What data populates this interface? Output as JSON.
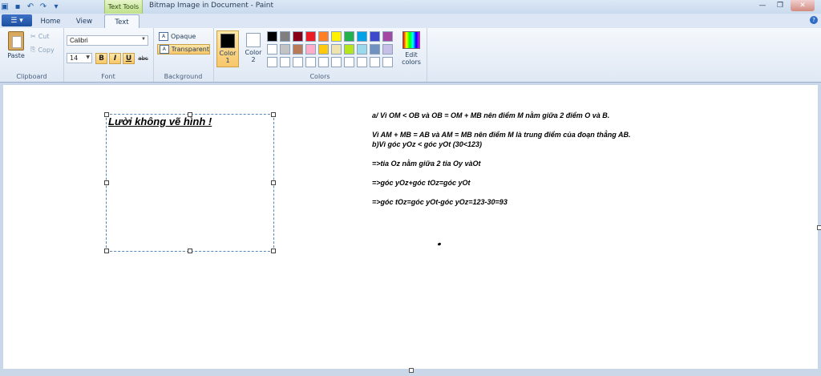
{
  "titlebar": {
    "context_tab": "Text Tools",
    "window_title": "Bitmap Image in Document - Paint",
    "qat_icons": [
      "paint-icon",
      "save-icon",
      "undo-icon",
      "redo-icon",
      "customize-icon"
    ]
  },
  "tabs": [
    {
      "label": "Home"
    },
    {
      "label": "View"
    },
    {
      "label": "Text"
    }
  ],
  "ribbon": {
    "clipboard": {
      "paste": "Paste",
      "cut": "Cut",
      "copy": "Copy",
      "group_label": "Clipboard"
    },
    "font": {
      "family": "Calibri",
      "size": "14",
      "bold": "B",
      "italic": "I",
      "underline": "U",
      "strike": "abc",
      "group_label": "Font"
    },
    "background": {
      "opaque": "Opaque",
      "transparent": "Transparent",
      "group_label": "Background"
    },
    "colors": {
      "color1_label": "Color 1",
      "color2_label": "Color 2",
      "color1": "#000000",
      "color2": "#ffffff",
      "edit_label": "Edit colors",
      "group_label": "Colors",
      "palette": [
        "#000000",
        "#7f7f7f",
        "#880015",
        "#ed1c24",
        "#ff7f27",
        "#fff200",
        "#22b14c",
        "#00a2e8",
        "#3f48cc",
        "#a349a4",
        "#ffffff",
        "#c3c3c3",
        "#b97a57",
        "#ffaec9",
        "#ffc90e",
        "#efe4b0",
        "#b5e61d",
        "#99d9ea",
        "#7092be",
        "#c8bfe7",
        "#ffffff",
        "#ffffff",
        "#ffffff",
        "#ffffff",
        "#ffffff",
        "#ffffff",
        "#ffffff",
        "#ffffff",
        "#ffffff",
        "#ffffff"
      ]
    }
  },
  "canvas": {
    "textbox_text": "Lười không vẽ hình !",
    "lines": [
      "a/ Vì OM < OB và OB = OM + MB nên điểm M nằm giữa 2 điểm O và B.",
      "Vì AM + MB = AB và AM = MB nên điểm M là trung điểm của đoạn thẳng AB.",
      "b)Vì góc yOz < góc yOt  (30<123)",
      "=>tia Oz nằm giữa 2 tia Oy vàOt",
      "=>góc yOz+góc tOz=góc yOt",
      "=>góc tOz=góc yOt-góc yOz=123-30=93"
    ]
  }
}
